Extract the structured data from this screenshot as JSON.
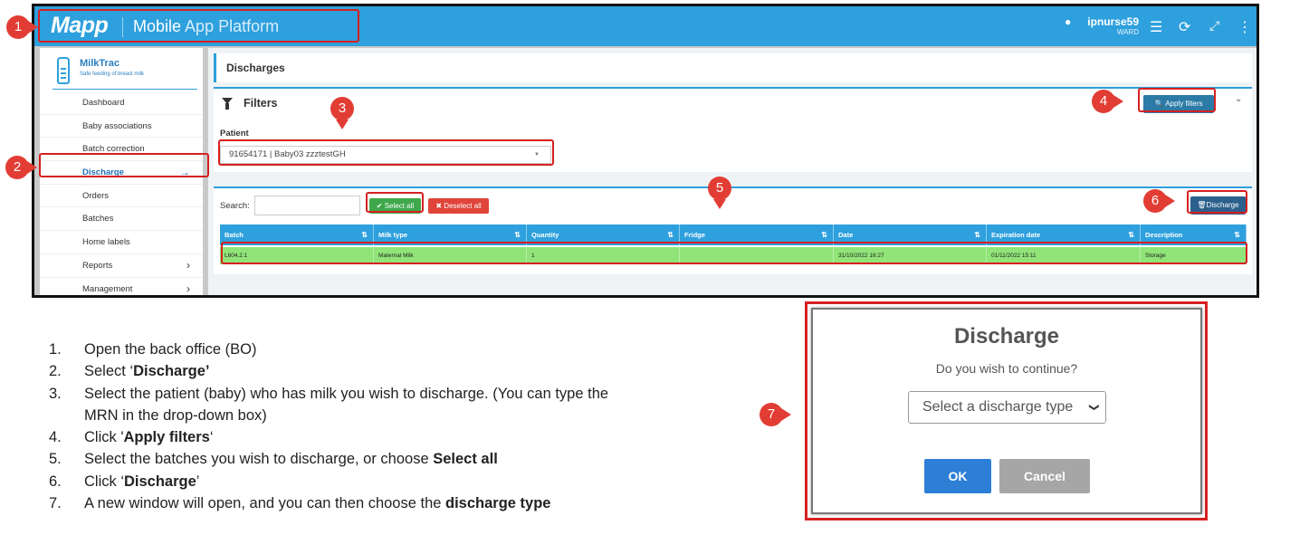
{
  "header": {
    "logo": "Mapp",
    "title_strong": "Mobile",
    "title_light": "App Platform",
    "user_icon": "user-icon",
    "username": "ipnurse59",
    "role": "WARD",
    "icons": [
      "menu-icon",
      "refresh-icon",
      "fullscreen-icon",
      "more-icon"
    ]
  },
  "sidebar": {
    "brand": "MilkTrac",
    "tagline": "Safe feeding of breast milk",
    "items": [
      {
        "label": "Dashboard"
      },
      {
        "label": "Baby associations"
      },
      {
        "label": "Batch correction"
      },
      {
        "label": "Discharge",
        "active": true
      },
      {
        "label": "Orders"
      },
      {
        "label": "Batches"
      },
      {
        "label": "Home labels"
      },
      {
        "label": "Reports"
      },
      {
        "label": "Management"
      }
    ]
  },
  "main": {
    "breadcrumb": "Discharges",
    "filters": {
      "title": "Filters",
      "apply_label": "Apply filters",
      "patient_label": "Patient",
      "patient_value": "91654171 | Baby03 zzztestGH"
    },
    "grid": {
      "search_label": "Search:",
      "select_all": "✔ Select all",
      "deselect_all": "✖ Deselect all",
      "discharge": "Discharge",
      "columns": [
        "Batch",
        "Milk type",
        "Quantity",
        "Fridge",
        "Date",
        "Expiration date",
        "Description"
      ],
      "rows": [
        [
          "L604.2.1",
          "Maternal Milk",
          "1",
          "",
          "31/10/2022 16:27",
          "01/11/2022 15:11",
          "Storage"
        ]
      ]
    }
  },
  "steps": [
    {
      "num": "1.",
      "text": "Open the back office (BO)"
    },
    {
      "num": "2.",
      "pre": "Select ‘",
      "bold": "Discharge’",
      "post": ""
    },
    {
      "num": "3.",
      "text": "Select the patient (baby) who has milk you wish to discharge.  (You can type the MRN in the drop-down box)"
    },
    {
      "num": "4.",
      "pre": "Click '",
      "bold": "Apply filters",
      "post": "‘"
    },
    {
      "num": "5.",
      "pre": "Select the batches you wish to discharge, or choose ",
      "bold": "Select all",
      "post": ""
    },
    {
      "num": "6.",
      "pre": "Click ‘",
      "bold": "Discharge",
      "post": "’"
    },
    {
      "num": "7.",
      "pre": "A new window will open, and you can then choose the ",
      "bold": "discharge type",
      "post": ""
    }
  ],
  "dialog": {
    "title": "Discharge",
    "question": "Do you wish to continue?",
    "select_placeholder": "Select a discharge type",
    "ok": "OK",
    "cancel": "Cancel"
  },
  "markers": [
    "1",
    "2",
    "3",
    "4",
    "5",
    "6",
    "7"
  ],
  "colors": {
    "accent": "#2ea0dd",
    "highlight": "#d62020",
    "row_selected": "#90e478",
    "select_all": "#3ea84a",
    "deselect_all": "#e0443a"
  }
}
